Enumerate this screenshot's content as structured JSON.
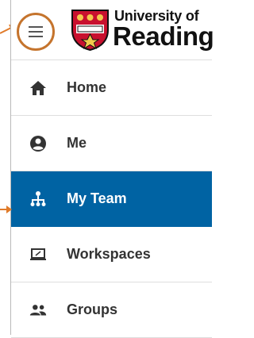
{
  "logo": {
    "line1": "University of",
    "line2": "Reading"
  },
  "menu_button": {
    "icon": "hamburger-menu-icon"
  },
  "nav": {
    "items": [
      {
        "label": "Home",
        "icon": "home-icon",
        "active": false
      },
      {
        "label": "Me",
        "icon": "account-circle-icon",
        "active": false
      },
      {
        "label": "My Team",
        "icon": "team-hierarchy-icon",
        "active": true
      },
      {
        "label": "Workspaces",
        "icon": "laptop-icon",
        "active": false
      },
      {
        "label": "Groups",
        "icon": "people-icon",
        "active": false
      }
    ]
  },
  "colors": {
    "accent_active": "#0063a3",
    "highlight_circle": "#c5742d",
    "annotation_arrow": "#e07b2a",
    "text": "#333333"
  }
}
